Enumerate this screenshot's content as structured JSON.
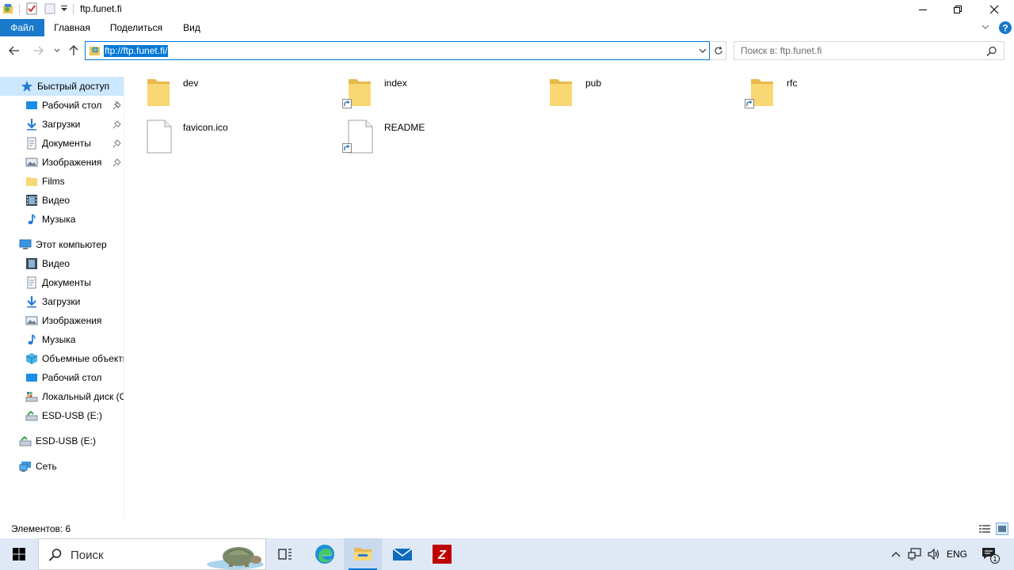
{
  "window": {
    "title": "ftp.funet.fi"
  },
  "ribbon": {
    "tabs": [
      {
        "label": "Файл"
      },
      {
        "label": "Главная"
      },
      {
        "label": "Поделиться"
      },
      {
        "label": "Вид"
      }
    ]
  },
  "address": {
    "value": "ftp://ftp.funet.fi/"
  },
  "search": {
    "placeholder": "Поиск в: ftp.funet.fi"
  },
  "sidebar": {
    "quick_access": {
      "label": "Быстрый доступ",
      "items": [
        {
          "label": "Рабочий стол",
          "icon": "desktop-icon",
          "pinned": true
        },
        {
          "label": "Загрузки",
          "icon": "downloads-icon",
          "pinned": true
        },
        {
          "label": "Документы",
          "icon": "documents-icon",
          "pinned": true
        },
        {
          "label": "Изображения",
          "icon": "pictures-icon",
          "pinned": true
        },
        {
          "label": "Films",
          "icon": "folder-icon",
          "pinned": false
        },
        {
          "label": "Видео",
          "icon": "video-icon",
          "pinned": false
        },
        {
          "label": "Музыка",
          "icon": "music-icon",
          "pinned": false
        }
      ]
    },
    "this_pc": {
      "label": "Этот компьютер",
      "items": [
        {
          "label": "Видео",
          "icon": "video-icon"
        },
        {
          "label": "Документы",
          "icon": "documents-icon"
        },
        {
          "label": "Загрузки",
          "icon": "downloads-icon"
        },
        {
          "label": "Изображения",
          "icon": "pictures-icon"
        },
        {
          "label": "Музыка",
          "icon": "music-icon"
        },
        {
          "label": "Объемные объекты",
          "icon": "3d-objects-icon"
        },
        {
          "label": "Рабочий стол",
          "icon": "desktop-icon"
        },
        {
          "label": "Локальный диск (C:)",
          "icon": "local-disk-icon"
        },
        {
          "label": "ESD-USB (E:)",
          "icon": "usb-drive-icon"
        }
      ]
    },
    "usb": {
      "label": "ESD-USB (E:)"
    },
    "network": {
      "label": "Сеть"
    }
  },
  "files": [
    {
      "name": "dev",
      "type": "folder",
      "shortcut": false
    },
    {
      "name": "index",
      "type": "folder",
      "shortcut": true
    },
    {
      "name": "pub",
      "type": "folder",
      "shortcut": false
    },
    {
      "name": "rfc",
      "type": "folder",
      "shortcut": true
    },
    {
      "name": "favicon.ico",
      "type": "file",
      "shortcut": false
    },
    {
      "name": "README",
      "type": "file",
      "shortcut": true
    }
  ],
  "status": {
    "items_count": "Элементов: 6"
  },
  "taskbar": {
    "search_placeholder": "Поиск",
    "language": "ENG",
    "notification_count": "1"
  },
  "colors": {
    "accent": "#0078d7",
    "file_tab": "#1979ca",
    "selected": "#cce8ff",
    "folder": "#f8d775",
    "taskbar": "#dfe9f5"
  }
}
